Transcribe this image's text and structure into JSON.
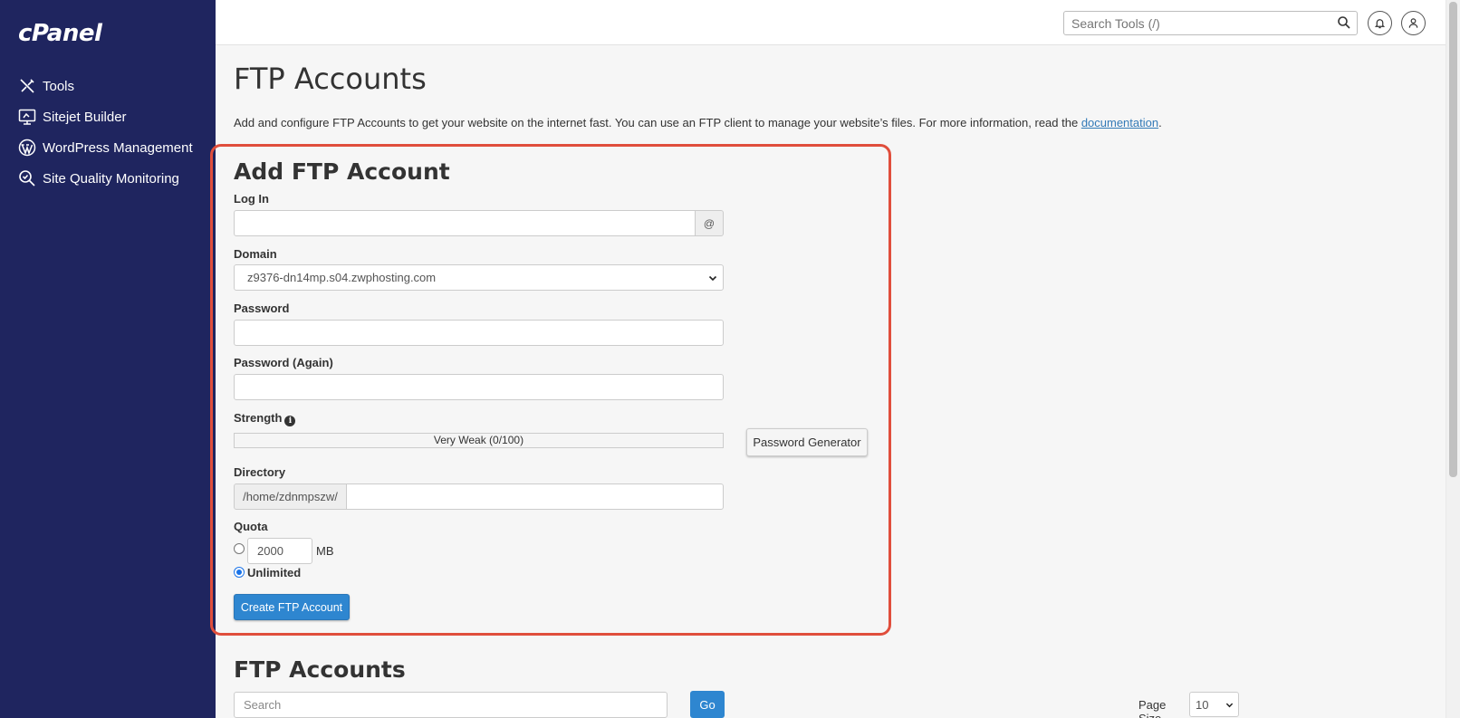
{
  "sidebar": {
    "logo": "cPanel",
    "items": [
      {
        "label": "Tools",
        "icon": "tools-icon"
      },
      {
        "label": "Sitejet Builder",
        "icon": "monitor-icon"
      },
      {
        "label": "WordPress Management",
        "icon": "wordpress-icon"
      },
      {
        "label": "Site Quality Monitoring",
        "icon": "magnifier-check-icon"
      }
    ]
  },
  "topbar": {
    "search_placeholder": "Search Tools (/)"
  },
  "page": {
    "title": "FTP Accounts",
    "intro": "Add and configure FTP Accounts to get your website on the internet fast. You can use an FTP client to manage your website’s files. For more information, read the ",
    "intro_link": "documentation",
    "intro_end": "."
  },
  "add_form": {
    "title": "Add FTP Account",
    "login_label": "Log In",
    "login_value": "",
    "at_symbol": "@",
    "domain_label": "Domain",
    "domain_value": "z9376-dn14mp.s04.zwphosting.com",
    "password_label": "Password",
    "password_again_label": "Password (Again)",
    "strength_label": "Strength",
    "strength_value": "Very Weak (0/100)",
    "password_generator": "Password Generator",
    "directory_label": "Directory",
    "directory_prefix": "/home/zdnmpszw/",
    "quota_label": "Quota",
    "quota_value": "2000",
    "quota_unit": "MB",
    "unlimited_label": "Unlimited",
    "unlimited_selected": true,
    "create_button": "Create FTP Account"
  },
  "list": {
    "title": "FTP Accounts",
    "search_placeholder": "Search",
    "go_button": "Go",
    "page_size_label": "Page Size",
    "page_size_value": "10"
  },
  "colors": {
    "sidebar_bg": "#1f255f",
    "accent_blue": "#2e86d0",
    "highlight_red": "#e04e3c"
  }
}
